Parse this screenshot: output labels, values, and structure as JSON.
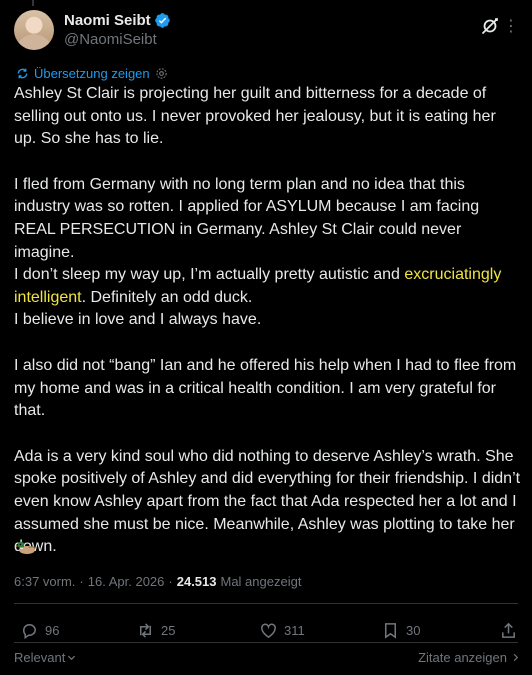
{
  "author": {
    "display_name": "Naomi Seibt",
    "handle": "@NaomiSeibt"
  },
  "translate_label": "Übersetzung zeigen",
  "post": {
    "paragraphs": [
      "Ashley St Clair is projecting her guilt and bitterness for a decade of selling out onto us. I never provoked her jealousy, but it is eating her up. So she has to lie.",
      "I fled from Germany with no long term plan and no idea that this industry was so rotten. I applied for ASYLUM because I am facing REAL PERSECUTION in Germany. Ashley St Clair could never imagine.",
      "I don’t sleep my way up, I’m actually pretty autistic and ",
      "excruciatingly intelligent",
      ". Definitely an odd duck.",
      "I believe in love and I always have.",
      "I also did not “bang” Ian and he offered his help when I had to flee from my home and was in a critical health condition. I am very grateful for that.",
      "Ada is a very kind soul who did nothing to deserve Ashley’s wrath. She spoke positively of Ashley and did everything for their friendship. I didn’t even know Ashley apart from the fact that Ada respected her a lot and I assumed she must be nice. Meanwhile, Ashley was plotting to take her down."
    ],
    "highlight_color": "#f0e442"
  },
  "meta": {
    "time": "6:37 vorm.",
    "separator": "·",
    "date": "16. Apr. 2026",
    "views": "24.513",
    "views_label": "Mal angezeigt"
  },
  "actions": {
    "replies": "96",
    "reposts": "25",
    "likes": "311",
    "bookmarks": "30"
  },
  "footer": {
    "sort_label": "Relevant",
    "quotes_label": "Zitate anzeigen"
  },
  "colors": {
    "accent": "#1d9bf0",
    "muted": "#71767b",
    "text": "#e7e9ea",
    "background": "#000000"
  }
}
